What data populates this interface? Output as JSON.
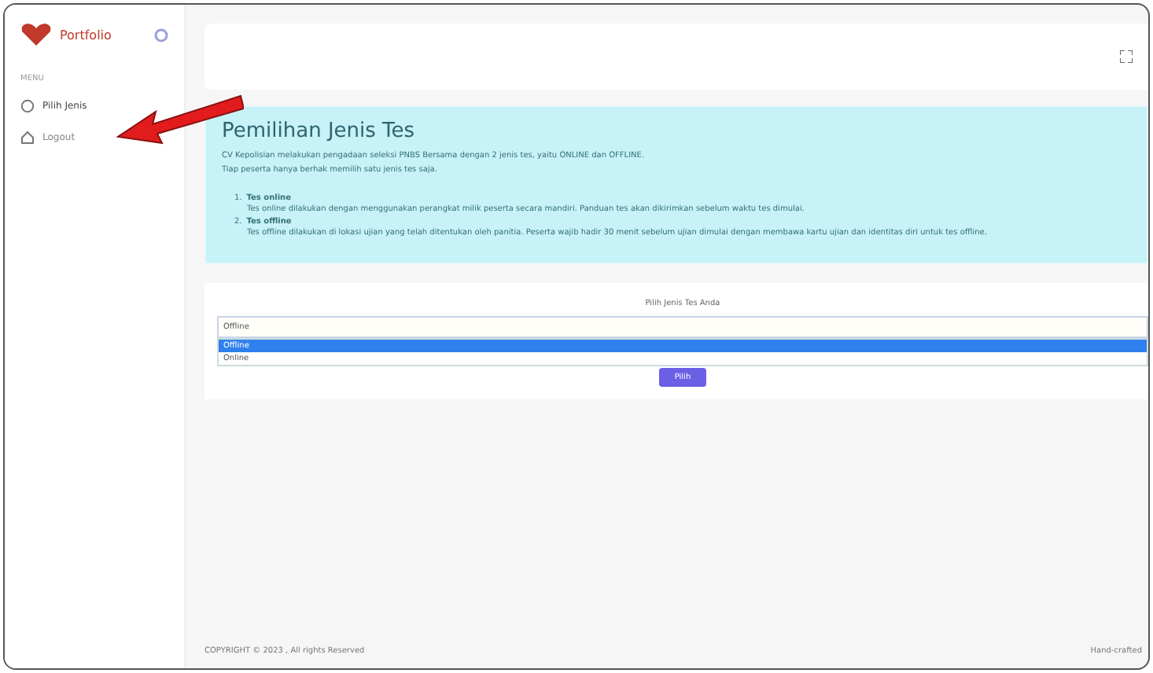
{
  "sidebar": {
    "brand": "Portfolio",
    "section": "MENU",
    "items": [
      {
        "label": "Pilih Jenis",
        "kind": "circle",
        "selected": true
      },
      {
        "label": "Logout",
        "kind": "house",
        "selected": false
      }
    ]
  },
  "info": {
    "title": "Pemilihan Jenis Tes",
    "intro": [
      "CV Kepolisian melakukan pengadaan seleksi PNBS Bersama dengan 2 jenis tes, yaitu ONLINE dan OFFLINE.",
      "Tiap peserta hanya berhak memilih satu jenis tes saja."
    ],
    "options": [
      {
        "marker": "1.",
        "title": "Tes online",
        "text": "Tes online dilakukan dengan menggunakan perangkat milik peserta secara mandiri. Panduan tes akan dikirimkan sebelum waktu tes dimulai."
      },
      {
        "marker": "2.",
        "title": "Tes offline",
        "text": "Tes offline dilakukan di lokasi ujian yang telah ditentukan oleh panitia. Peserta wajib hadir 30 menit sebelum ujian dimulai dengan membawa kartu ujian dan identitas diri untuk tes offline."
      }
    ]
  },
  "form": {
    "label": "Pilih Jenis Tes Anda",
    "value": "Offline",
    "dropdown": [
      {
        "label": "Offline",
        "selected": true
      },
      {
        "label": "Online",
        "selected": false
      }
    ],
    "button": "Pilih"
  },
  "footer": {
    "left": "COPYRIGHT © 2023 , All rights Reserved",
    "right": "Hand-crafted"
  }
}
